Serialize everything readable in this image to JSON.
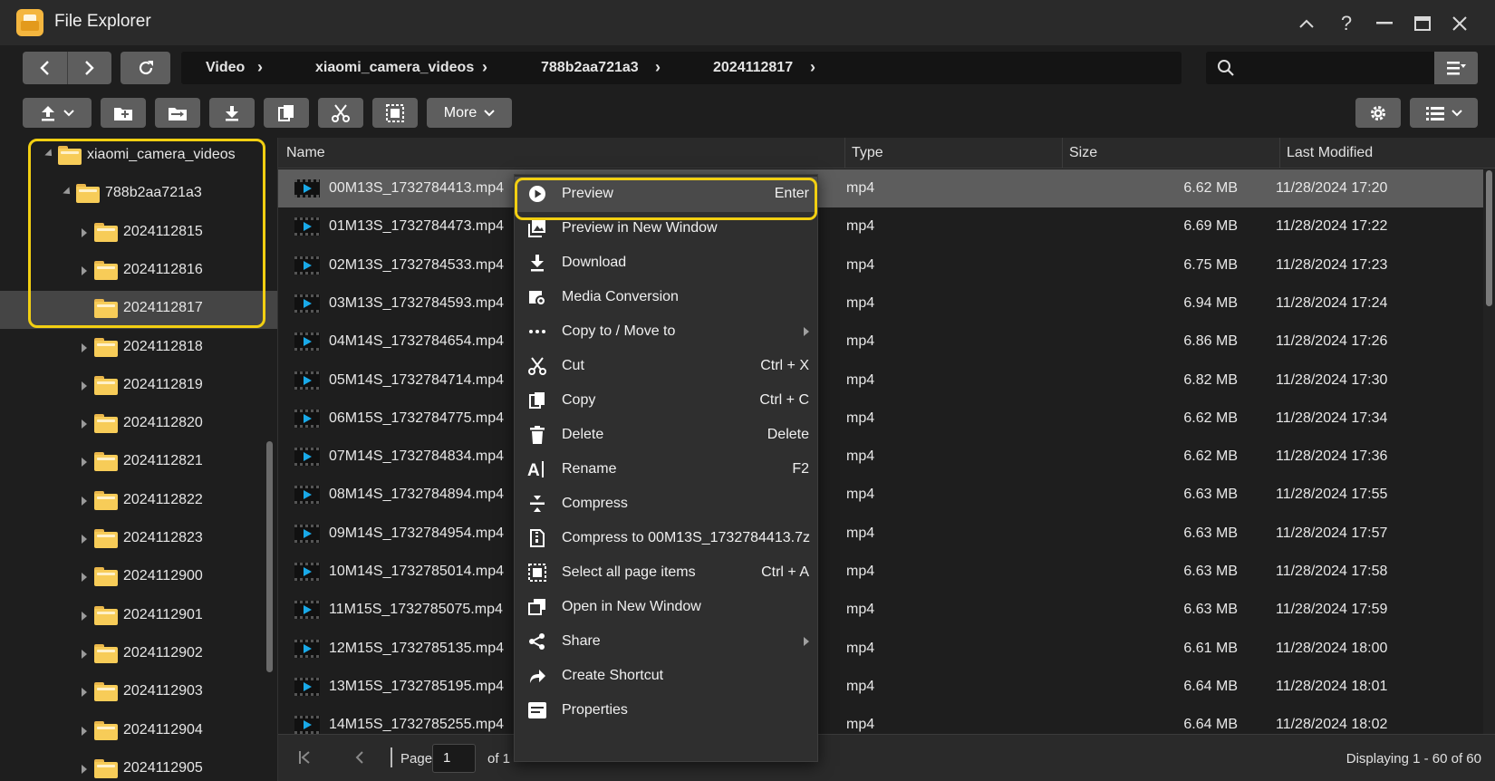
{
  "window": {
    "title": "File Explorer"
  },
  "breadcrumb": [
    "Video",
    "xiaomi_camera_videos",
    "788b2aa721a3",
    "2024112817"
  ],
  "search": {
    "placeholder": ""
  },
  "toolbar": {
    "more_label": "More"
  },
  "sidebar": {
    "items": [
      {
        "label": "xiaomi_camera_videos",
        "level": 0,
        "expanded": true
      },
      {
        "label": "788b2aa721a3",
        "level": 1,
        "expanded": true
      },
      {
        "label": "2024112815",
        "level": 2
      },
      {
        "label": "2024112816",
        "level": 2
      },
      {
        "label": "2024112817",
        "level": 2,
        "selected": true
      },
      {
        "label": "2024112818",
        "level": 2
      },
      {
        "label": "2024112819",
        "level": 2
      },
      {
        "label": "2024112820",
        "level": 2
      },
      {
        "label": "2024112821",
        "level": 2
      },
      {
        "label": "2024112822",
        "level": 2
      },
      {
        "label": "2024112823",
        "level": 2
      },
      {
        "label": "2024112900",
        "level": 2
      },
      {
        "label": "2024112901",
        "level": 2
      },
      {
        "label": "2024112902",
        "level": 2
      },
      {
        "label": "2024112903",
        "level": 2
      },
      {
        "label": "2024112904",
        "level": 2
      },
      {
        "label": "2024112905",
        "level": 2
      }
    ]
  },
  "list": {
    "columns": [
      "Name",
      "Type",
      "Size",
      "Last Modified"
    ],
    "rows": [
      {
        "name": "00M13S_1732784413.mp4",
        "type": "mp4",
        "size": "6.62 MB",
        "modified": "11/28/2024 17:20",
        "selected": true
      },
      {
        "name": "01M13S_1732784473.mp4",
        "type": "mp4",
        "size": "6.69 MB",
        "modified": "11/28/2024 17:22"
      },
      {
        "name": "02M13S_1732784533.mp4",
        "type": "mp4",
        "size": "6.75 MB",
        "modified": "11/28/2024 17:23"
      },
      {
        "name": "03M13S_1732784593.mp4",
        "type": "mp4",
        "size": "6.94 MB",
        "modified": "11/28/2024 17:24"
      },
      {
        "name": "04M14S_1732784654.mp4",
        "type": "mp4",
        "size": "6.86 MB",
        "modified": "11/28/2024 17:26"
      },
      {
        "name": "05M14S_1732784714.mp4",
        "type": "mp4",
        "size": "6.82 MB",
        "modified": "11/28/2024 17:30"
      },
      {
        "name": "06M15S_1732784775.mp4",
        "type": "mp4",
        "size": "6.62 MB",
        "modified": "11/28/2024 17:34"
      },
      {
        "name": "07M14S_1732784834.mp4",
        "type": "mp4",
        "size": "6.62 MB",
        "modified": "11/28/2024 17:36"
      },
      {
        "name": "08M14S_1732784894.mp4",
        "type": "mp4",
        "size": "6.63 MB",
        "modified": "11/28/2024 17:55"
      },
      {
        "name": "09M14S_1732784954.mp4",
        "type": "mp4",
        "size": "6.63 MB",
        "modified": "11/28/2024 17:57"
      },
      {
        "name": "10M14S_1732785014.mp4",
        "type": "mp4",
        "size": "6.63 MB",
        "modified": "11/28/2024 17:58"
      },
      {
        "name": "11M15S_1732785075.mp4",
        "type": "mp4",
        "size": "6.63 MB",
        "modified": "11/28/2024 17:59"
      },
      {
        "name": "12M15S_1732785135.mp4",
        "type": "mp4",
        "size": "6.61 MB",
        "modified": "11/28/2024 18:00"
      },
      {
        "name": "13M15S_1732785195.mp4",
        "type": "mp4",
        "size": "6.64 MB",
        "modified": "11/28/2024 18:01"
      },
      {
        "name": "14M15S_1732785255.mp4",
        "type": "mp4",
        "size": "6.64 MB",
        "modified": "11/28/2024 18:02"
      }
    ]
  },
  "pager": {
    "page_label": "Page",
    "page_value": "1",
    "of_label": "of 1",
    "display_text": "Displaying 1 - 60 of 60"
  },
  "context_menu": {
    "items": [
      {
        "label": "Preview",
        "shortcut": "Enter",
        "icon": "play-circle-icon",
        "active": true
      },
      {
        "label": "Preview in New Window",
        "shortcut": "",
        "icon": "image-window-icon"
      },
      {
        "label": "Download",
        "shortcut": "",
        "icon": "download-icon"
      },
      {
        "label": "Media Conversion",
        "shortcut": "",
        "icon": "media-convert-icon"
      },
      {
        "label": "Copy to / Move to",
        "shortcut": "",
        "icon": "more-dots-icon",
        "submenu": true
      },
      {
        "label": "Cut",
        "shortcut": "Ctrl + X",
        "icon": "scissors-icon"
      },
      {
        "label": "Copy",
        "shortcut": "Ctrl + C",
        "icon": "copy-icon"
      },
      {
        "label": "Delete",
        "shortcut": "Delete",
        "icon": "trash-icon"
      },
      {
        "label": "Rename",
        "shortcut": "F2",
        "icon": "rename-icon"
      },
      {
        "label": "Compress",
        "shortcut": "",
        "icon": "compress-icon"
      },
      {
        "label": "Compress to 00M13S_1732784413.7z",
        "shortcut": "",
        "icon": "archive-icon"
      },
      {
        "label": "Select all page items",
        "shortcut": "Ctrl + A",
        "icon": "select-all-icon"
      },
      {
        "label": "Open in New Window",
        "shortcut": "",
        "icon": "new-window-icon"
      },
      {
        "label": "Share",
        "shortcut": "",
        "icon": "share-icon",
        "submenu": true
      },
      {
        "label": "Create Shortcut",
        "shortcut": "",
        "icon": "shortcut-arrow-icon"
      },
      {
        "label": "Properties",
        "shortcut": "",
        "icon": "properties-icon"
      }
    ]
  },
  "colors": {
    "highlight": "#f2cf12",
    "accent_play": "#19a9e8",
    "folder": "#f7cc58"
  }
}
